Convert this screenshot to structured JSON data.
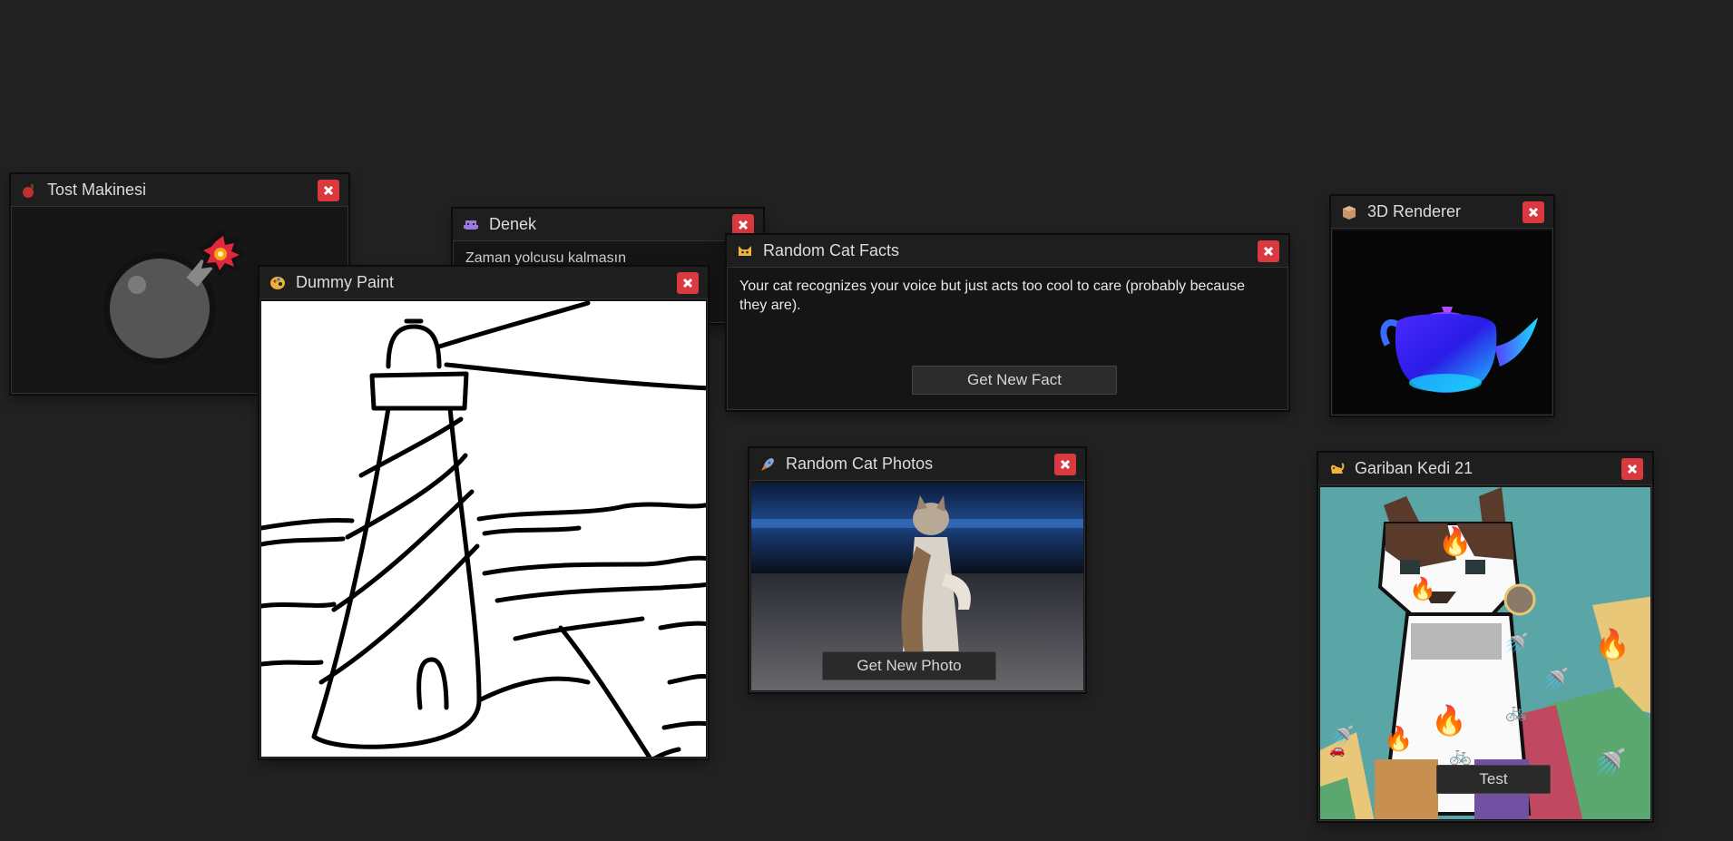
{
  "windows": {
    "tost": {
      "title": "Tost Makinesi"
    },
    "denek": {
      "title": "Denek",
      "text": "Zaman yolcusu kalmasın"
    },
    "paint": {
      "title": "Dummy Paint"
    },
    "facts": {
      "title": "Random Cat Facts",
      "fact": "Your cat recognizes your voice but just acts too cool to care (probably because they are).",
      "button": "Get New Fact"
    },
    "renderer": {
      "title": "3D Renderer"
    },
    "photos": {
      "title": "Random Cat Photos",
      "button": "Get New Photo"
    },
    "kedi": {
      "title": "Gariban Kedi 21",
      "button": "Test"
    }
  },
  "colors": {
    "desktop": "#222222",
    "close": "#d9393f",
    "kedi_bg": "#5aa6a6"
  },
  "icons": {
    "tost": "bomb-icon",
    "denek": "alien-icon",
    "paint": "palette-icon",
    "facts": "cat-face-icon",
    "renderer": "box-icon",
    "photos": "rocket-icon",
    "kedi": "cat-icon",
    "close": "close-icon"
  }
}
